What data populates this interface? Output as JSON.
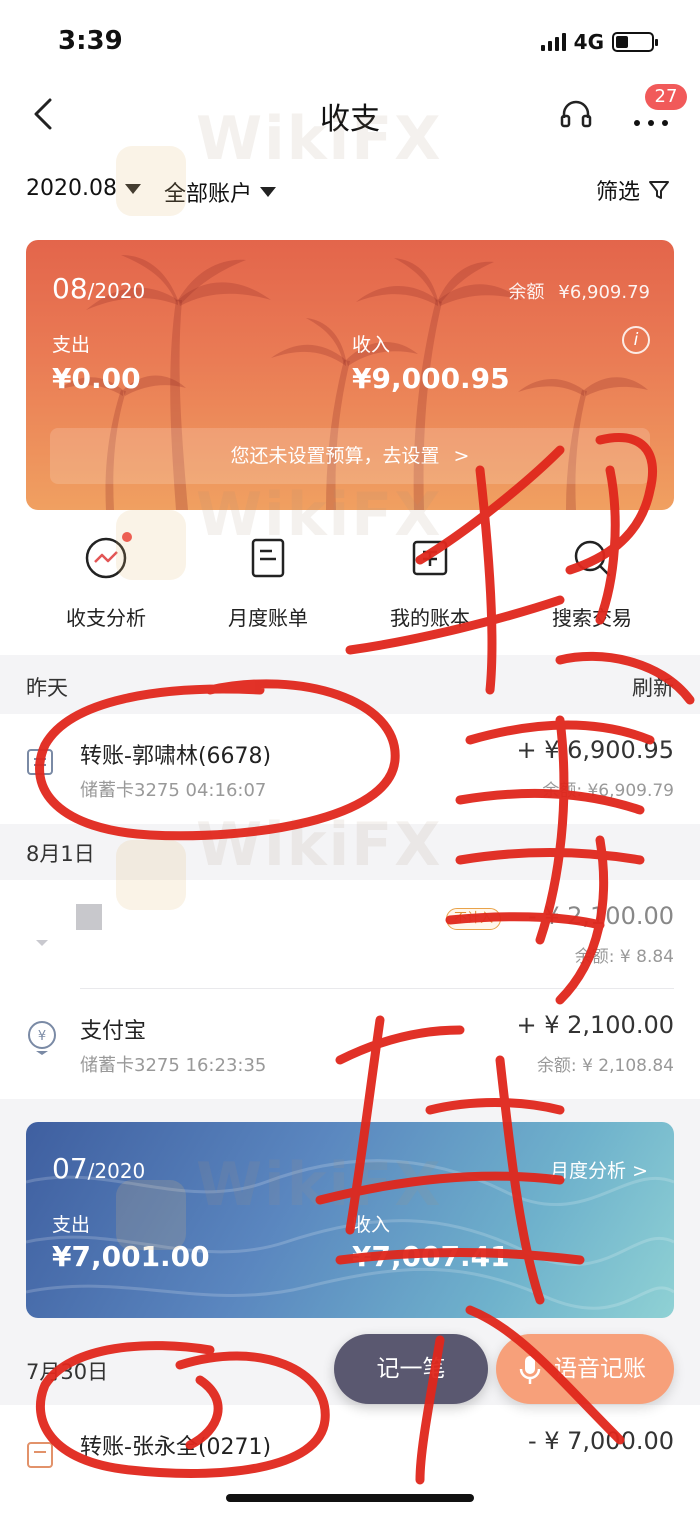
{
  "status_bar": {
    "time": "3:39",
    "network": "4G",
    "battery_level": 0.35
  },
  "nav": {
    "title": "收支",
    "badge_count": "27"
  },
  "filters": {
    "month": "2020.08",
    "account": "全部账户",
    "filter_label": "筛选"
  },
  "august_card": {
    "month": "08",
    "year_suffix": "/2020",
    "balance_label": "余额",
    "balance_value": "¥6,909.79",
    "expense_label": "支出",
    "expense_value": "¥0.00",
    "income_label": "收入",
    "income_value": "¥9,000.95",
    "budget_prompt": "您还未设置预算，去设置",
    "chevron": ">"
  },
  "quick_actions": [
    {
      "label": "收支分析",
      "icon": "trend-chart-icon"
    },
    {
      "label": "月度账单",
      "icon": "monthly-bill-icon"
    },
    {
      "label": "我的账本",
      "icon": "ledger-icon"
    },
    {
      "label": "搜索交易",
      "icon": "search-icon"
    }
  ],
  "sections": [
    {
      "date": "昨天",
      "action": "刷新",
      "transactions": [
        {
          "title": "转账-郭啸林(6678)",
          "sub": "储蓄卡3275 04:16:07",
          "amount": "+ ¥ 6,900.95",
          "balance": "余额: ¥6,909.79",
          "icon": "transfer-icon"
        }
      ]
    },
    {
      "date": "8月1日",
      "transactions": [
        {
          "title": "",
          "sub": "",
          "amount": "- ¥ 2,100.00",
          "balance": "余额: ¥ 8.84",
          "tag": "不计入",
          "icon": "transfer-icon"
        },
        {
          "title": "支付宝",
          "sub": "储蓄卡3275 16:23:35",
          "amount": "+ ¥ 2,100.00",
          "balance": "余额: ¥ 2,108.84",
          "icon": "yuan-coin-icon"
        }
      ]
    }
  ],
  "july_card": {
    "month": "07",
    "year_suffix": "/2020",
    "analysis_link": "月度分析",
    "chevron": ">",
    "expense_label": "支出",
    "expense_value": "¥7,001.00",
    "income_label": "收入",
    "income_value": "¥7,007.41"
  },
  "july_section": {
    "date": "7月30日",
    "transaction": {
      "title": "转账-张永全(0271)",
      "amount": "- ¥ 7,000.00",
      "icon": "transfer-icon"
    }
  },
  "floating_actions": {
    "record_label": "记一笔",
    "voice_label": "语音记账"
  },
  "watermark_text": "WikiFX",
  "colors": {
    "august_card": "#e96d4f",
    "july_card": "#5a86bf",
    "voice_button": "#f7a07a",
    "record_button": "#5a5870",
    "scribble": "#e0271c",
    "badge": "#f15a5a"
  }
}
